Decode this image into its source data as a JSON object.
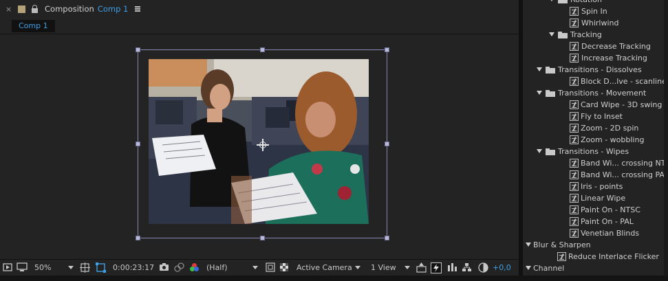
{
  "comp_panel": {
    "close_glyph": "×",
    "title": "Composition",
    "comp_name": "Comp 1",
    "tab_label": "Comp 1",
    "footer": {
      "zoom": "50%",
      "timecode": "0:00:23:17",
      "resolution": "(Half)",
      "camera": "Active Camera",
      "view": "1 View",
      "exposure": "+0,0"
    },
    "colors": {
      "accent": "#3ea0e6",
      "label_swatch": "#b5a27a",
      "layer_box": "#8a8ab4"
    }
  },
  "effects_panel": {
    "rows": [
      {
        "label": "Rotation",
        "kind": "folder",
        "level": 2
      },
      {
        "label": "Spin In",
        "kind": "preset",
        "level": 3
      },
      {
        "label": "Whirlwind",
        "kind": "preset",
        "level": 3
      },
      {
        "label": "Tracking",
        "kind": "folder",
        "level": 2
      },
      {
        "label": "Decrease Tracking",
        "kind": "preset",
        "level": 3
      },
      {
        "label": "Increase Tracking",
        "kind": "preset",
        "level": 3
      },
      {
        "label": "Transitions - Dissolves",
        "kind": "folder",
        "level": 1
      },
      {
        "label": "Block D...lve - scanlines",
        "kind": "preset",
        "level": 2
      },
      {
        "label": "Transitions - Movement",
        "kind": "folder",
        "level": 1
      },
      {
        "label": "Card Wipe - 3D swing",
        "kind": "preset",
        "level": 2
      },
      {
        "label": "Fly to Inset",
        "kind": "preset",
        "level": 2
      },
      {
        "label": "Zoom - 2D spin",
        "kind": "preset",
        "level": 2
      },
      {
        "label": "Zoom - wobbling",
        "kind": "preset",
        "level": 2
      },
      {
        "label": "Transitions - Wipes",
        "kind": "folder",
        "level": 1
      },
      {
        "label": "Band Wi... crossing NTSC",
        "kind": "preset",
        "level": 2
      },
      {
        "label": "Band Wi... crossing PAL",
        "kind": "preset",
        "level": 2
      },
      {
        "label": "Iris - points",
        "kind": "preset",
        "level": 2
      },
      {
        "label": "Linear Wipe",
        "kind": "preset",
        "level": 2
      },
      {
        "label": "Paint On - NTSC",
        "kind": "preset",
        "level": 2
      },
      {
        "label": "Paint On - PAL",
        "kind": "preset",
        "level": 2
      },
      {
        "label": "Venetian Blinds",
        "kind": "preset",
        "level": 2
      },
      {
        "label": "Blur & Sharpen",
        "kind": "category",
        "level": 0
      },
      {
        "label": "Reduce Interlace Flicker",
        "kind": "preset",
        "level": 1
      },
      {
        "label": "Channel",
        "kind": "category",
        "level": 0
      }
    ]
  }
}
